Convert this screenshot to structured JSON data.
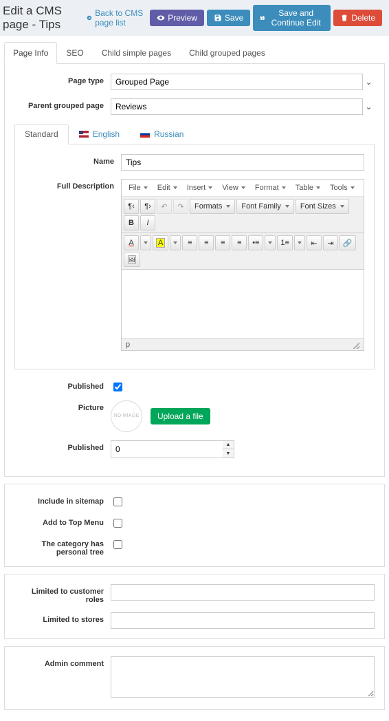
{
  "header": {
    "title": "Edit a CMS page - Tips",
    "back_label": "Back to CMS page list",
    "buttons": {
      "preview": "Preview",
      "save": "Save",
      "save_continue": "Save and Continue Edit",
      "delete": "Delete"
    }
  },
  "tabs": {
    "page_info": "Page Info",
    "seo": "SEO",
    "child_simple": "Child simple pages",
    "child_grouped": "Child grouped pages"
  },
  "form": {
    "page_type_label": "Page type",
    "page_type_value": "Grouped Page",
    "parent_label": "Parent grouped page",
    "parent_value": "Reviews",
    "lang_tabs": {
      "standard": "Standard",
      "english": "English",
      "russian": "Russian"
    },
    "name_label": "Name",
    "name_value": "Tips",
    "full_desc_label": "Full Description",
    "published_label": "Published",
    "published_checked": true,
    "picture_label": "Picture",
    "no_image_text": "NO IMAGE",
    "upload_label": "Upload a file",
    "published_num_label": "Published",
    "published_num_value": "0",
    "include_sitemap_label": "Include in sitemap",
    "add_top_menu_label": "Add to Top Menu",
    "personal_tree_label": "The category has personal tree",
    "limited_roles_label": "Limited to customer roles",
    "limited_stores_label": "Limited to stores",
    "admin_comment_label": "Admin comment"
  },
  "editor": {
    "menus": {
      "file": "File",
      "edit": "Edit",
      "insert": "Insert",
      "view": "View",
      "format": "Format",
      "table": "Table",
      "tools": "Tools"
    },
    "toolbar": {
      "formats": "Formats",
      "font_family": "Font Family",
      "font_sizes": "Font Sizes"
    },
    "status_path": "p"
  }
}
